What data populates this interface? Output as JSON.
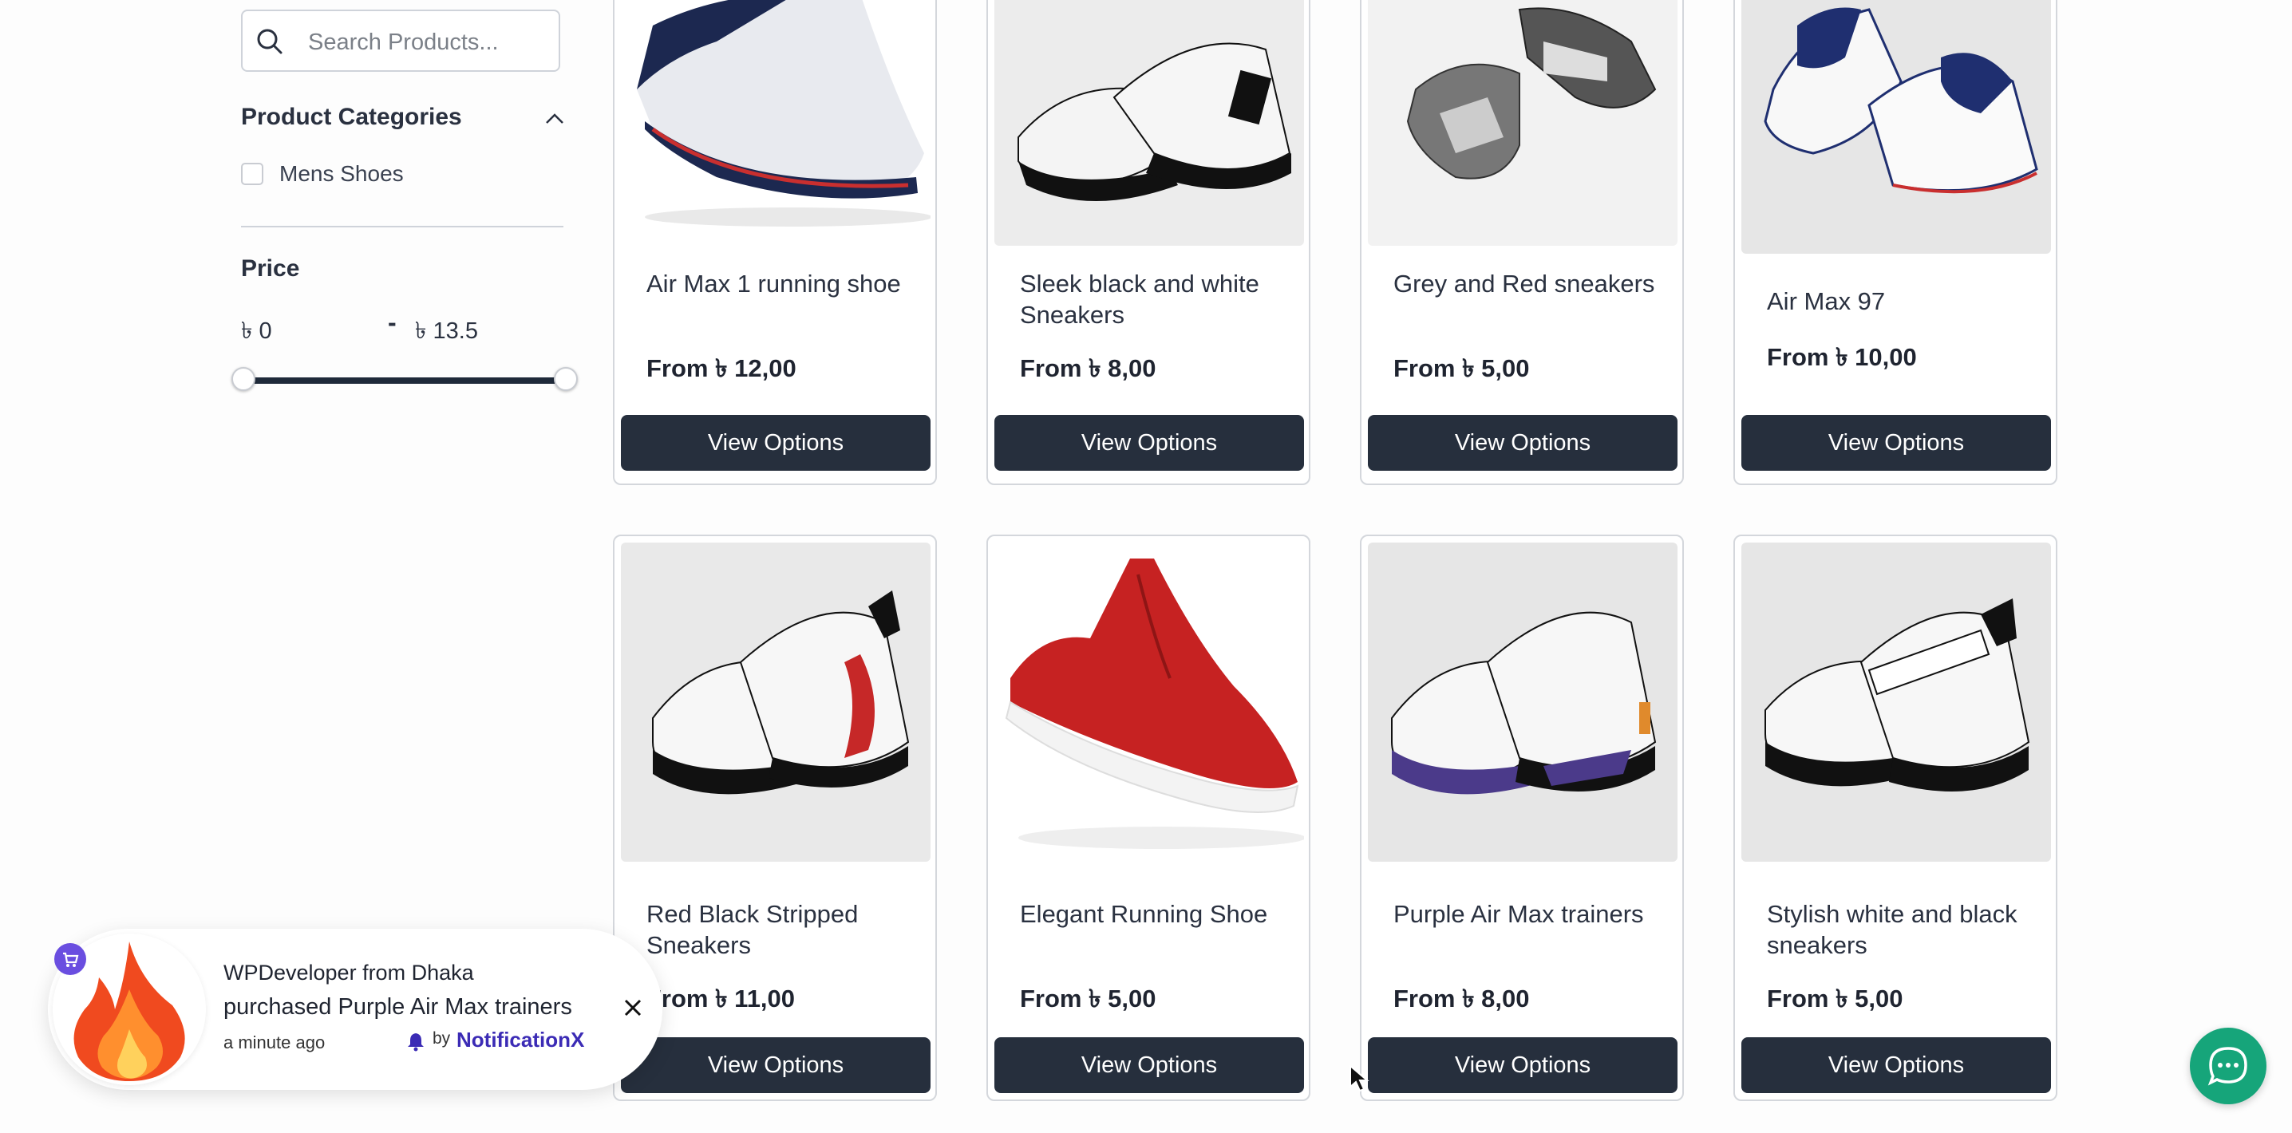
{
  "sidebar": {
    "search": {
      "placeholder": "Search Products..."
    },
    "categories": {
      "title": "Product Categories",
      "items": [
        {
          "label": "Mens Shoes",
          "checked": false
        }
      ]
    },
    "price": {
      "title": "Price",
      "min_label": "৳ 0",
      "separator": "-",
      "max_label": "৳ 13.5",
      "range_min": 0,
      "range_max": 13.5
    }
  },
  "products": [
    {
      "name": "Air Max 1 running shoe",
      "price": "From ৳ 12,00",
      "button": "View Options"
    },
    {
      "name": "Sleek black and white Sneakers",
      "price": "From ৳ 8,00",
      "button": "View Options"
    },
    {
      "name": "Grey and Red sneakers",
      "price": "From ৳ 5,00",
      "button": "View Options"
    },
    {
      "name": "Air Max 97",
      "price": "From ৳ 10,00",
      "button": "View Options"
    },
    {
      "name": "Red Black Stripped Sneakers",
      "price": "From ৳ 11,00",
      "button": "View Options"
    },
    {
      "name": "Elegant Running Shoe",
      "price": "From ৳ 5,00",
      "button": "View Options"
    },
    {
      "name": "Purple Air Max trainers",
      "price": "From ৳ 8,00",
      "button": "View Options"
    },
    {
      "name": "Stylish white and black sneakers",
      "price": "From ৳ 5,00",
      "button": "View Options"
    }
  ],
  "notification": {
    "line1": "WPDeveloper from Dhaka",
    "line2": "purchased Purple Air Max trainers",
    "time": "a minute ago",
    "by": "by",
    "brand": "NotificationX"
  },
  "colors": {
    "button": "#262f3d",
    "chat": "#16a57a",
    "brand": "#3b2bb5",
    "badge": "#6a4ee0"
  },
  "icons": [
    "search-icon",
    "chevron-up-icon",
    "shopping-cart-icon",
    "fire-icon",
    "close-icon",
    "chat-icon",
    "bell-icon"
  ]
}
